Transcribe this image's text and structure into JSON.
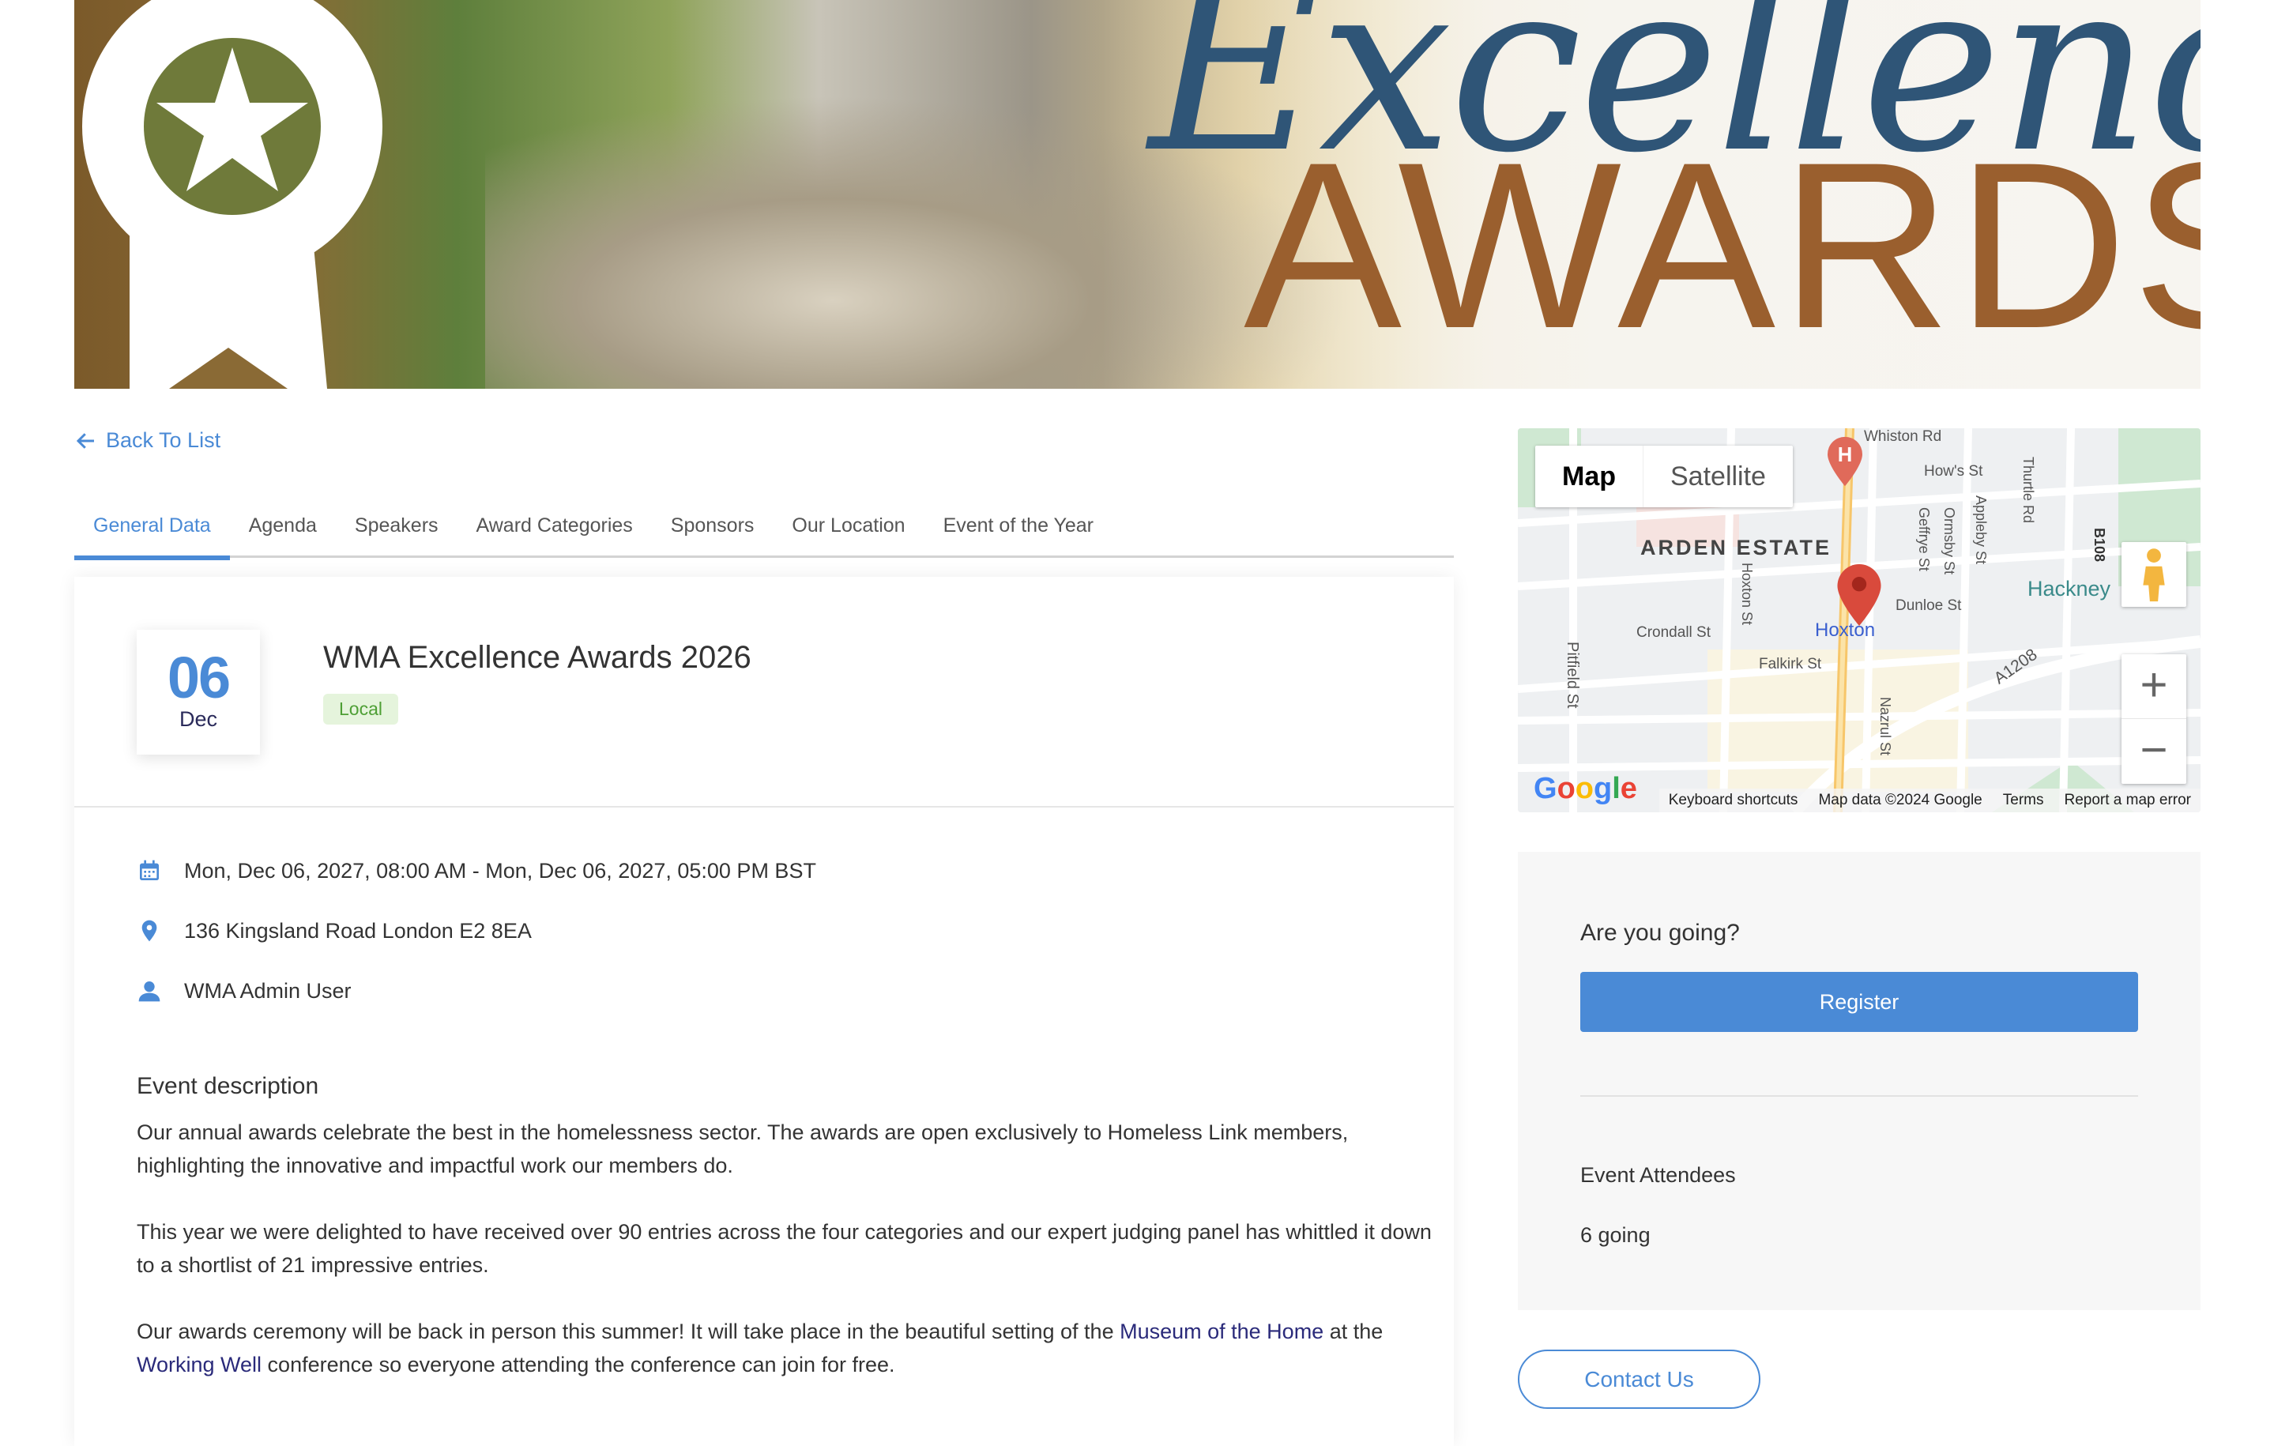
{
  "banner": {
    "logo_text_1": "Excellence",
    "logo_text_2": "AWARDS"
  },
  "nav": {
    "back_label": "Back To List"
  },
  "tabs": [
    {
      "label": "General Data",
      "active": true
    },
    {
      "label": "Agenda"
    },
    {
      "label": "Speakers"
    },
    {
      "label": "Award Categories"
    },
    {
      "label": "Sponsors"
    },
    {
      "label": "Our Location"
    },
    {
      "label": "Event of the Year"
    }
  ],
  "event": {
    "day": "06",
    "month": "Dec",
    "title": "WMA Excellence Awards 2026",
    "badge": "Local",
    "datetime": "Mon, Dec 06, 2027, 08:00 AM - Mon, Dec 06, 2027, 05:00 PM BST",
    "address": "136 Kingsland Road London E2 8EA",
    "organizer": "WMA Admin User",
    "description_heading": "Event description",
    "p1": "Our annual awards celebrate the best in the homelessness sector. The awards are open exclusively to Homeless Link members, highlighting the innovative and impactful work our members do.",
    "p2": "This year we were delighted to have received over 90 entries across the four categories and our expert judging panel has whittled it down to a shortlist of 21 impressive entries.",
    "p3a": "Our awards ceremony will be back in person this summer! It will take place in the beautiful setting of the ",
    "p3_link1": "Museum of the Home",
    "p3b": " at the ",
    "p3_link2": "Working Well",
    "p3c": " conference so everyone attending the conference can join for free."
  },
  "map": {
    "type_map": "Map",
    "type_satellite": "Satellite",
    "labels": {
      "area": "ARDEN ESTATE",
      "station": "Hoxton",
      "park": "Hackney",
      "s1": "Whiston Rd",
      "s2": "How's St",
      "s3": "Pitfield St",
      "s4": "Crondall St",
      "s5": "Falkirk St",
      "s6": "Dunloe St",
      "s7": "A1208",
      "s8": "Nazrul St",
      "s9": "Hoxton St",
      "s10": "Geffrye St",
      "s11": "Ormsby St",
      "s12": "Appleby St",
      "s13": "Thurtle Rd",
      "s14": "B108"
    },
    "footer": [
      "Keyboard shortcuts",
      "Map data ©2024 Google",
      "Terms",
      "Report a map error"
    ],
    "logo": "Google"
  },
  "rsvp": {
    "heading": "Are you going?",
    "register_label": "Register",
    "attendees_heading": "Event Attendees",
    "attendees_count": "6 going"
  },
  "contact_label": "Contact Us",
  "colors": {
    "accent": "#4a8ad6",
    "badge_bg": "#e5f4dc",
    "badge_text": "#4e9f35"
  }
}
